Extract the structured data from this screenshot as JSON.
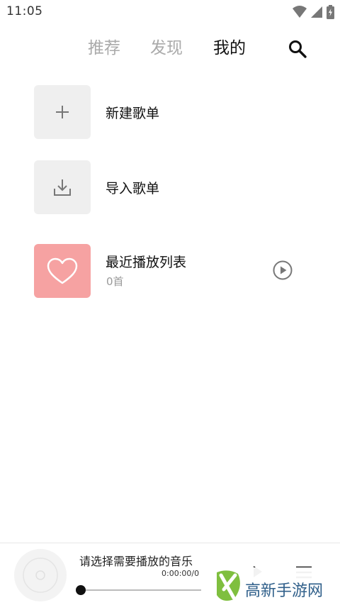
{
  "status_bar": {
    "time": "11:05"
  },
  "tabs": [
    {
      "label": "推荐"
    },
    {
      "label": "发现"
    },
    {
      "label": "我的"
    }
  ],
  "list": {
    "new_playlist": "新建歌单",
    "import_playlist": "导入歌单",
    "recent": {
      "title": "最近播放列表",
      "count": "0首"
    }
  },
  "player": {
    "title": "请选择需要播放的音乐",
    "time": "0:00:00/0",
    "progress": 0
  },
  "watermark": {
    "text": "高新手游网"
  },
  "colors": {
    "accent_heart": "#f6a2a2",
    "tile_bg": "#efefef",
    "tab_inactive": "#aaaaaa",
    "tab_active": "#111111",
    "watermark": "#2f5f8a"
  }
}
